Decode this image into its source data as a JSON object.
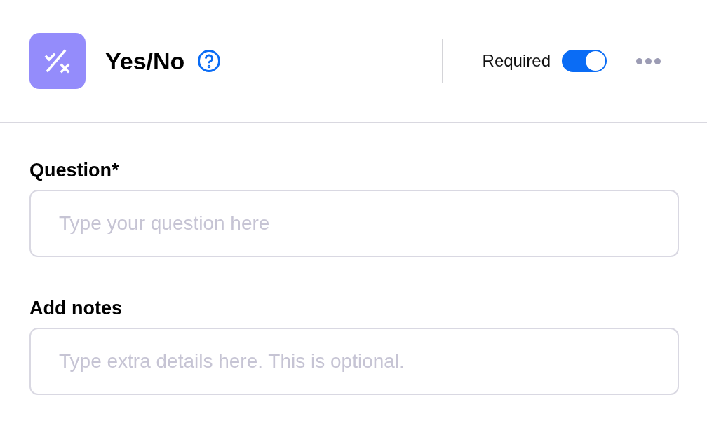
{
  "header": {
    "title": "Yes/No",
    "required": {
      "label": "Required",
      "on": true
    }
  },
  "fields": [
    {
      "label": "Question*",
      "placeholder": "Type your question here"
    },
    {
      "label": "Add notes",
      "placeholder": "Type extra details here. This is optional."
    }
  ]
}
